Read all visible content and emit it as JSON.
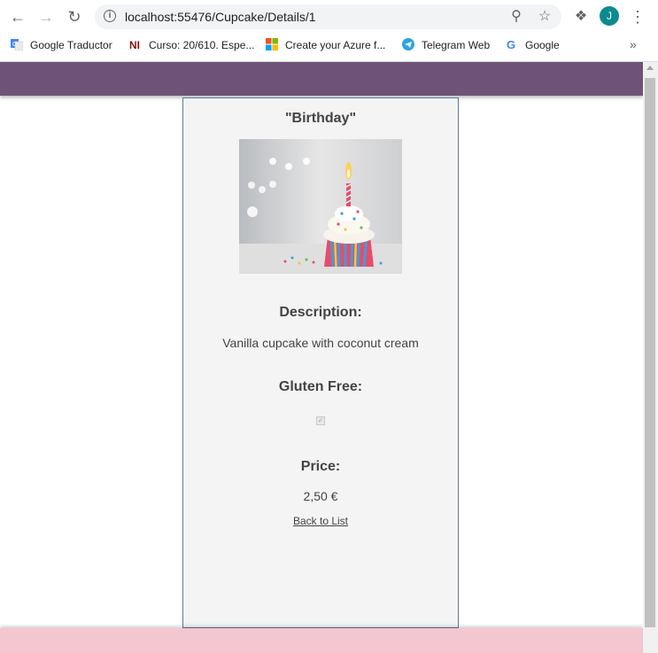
{
  "browser": {
    "url": "localhost:55476/Cupcake/Details/1",
    "profile_initial": "J",
    "bookmarks": [
      {
        "label": "Google Traductor",
        "icon": "google-translate-icon"
      },
      {
        "label": "Curso: 20/610. Espe...",
        "icon": "ni-icon"
      },
      {
        "label": "Create your Azure f...",
        "icon": "microsoft-icon"
      },
      {
        "label": "Telegram Web",
        "icon": "telegram-icon"
      },
      {
        "label": "Google",
        "icon": "google-icon"
      }
    ],
    "more_bookmarks": "»"
  },
  "page": {
    "name": "\"Birthday\"",
    "description_label": "Description:",
    "description": "Vanilla cupcake with coconut cream",
    "gluten_label": "Gluten Free:",
    "gluten_free": true,
    "price_label": "Price:",
    "price": "2,50 €",
    "back_link": "Back to List"
  },
  "colors": {
    "header_bar": "#6e5377",
    "footer_bar": "#f4c6d0",
    "card_background": "#f4f4f4",
    "card_border": "#5b7aa0",
    "avatar": "#0b8a8f"
  }
}
